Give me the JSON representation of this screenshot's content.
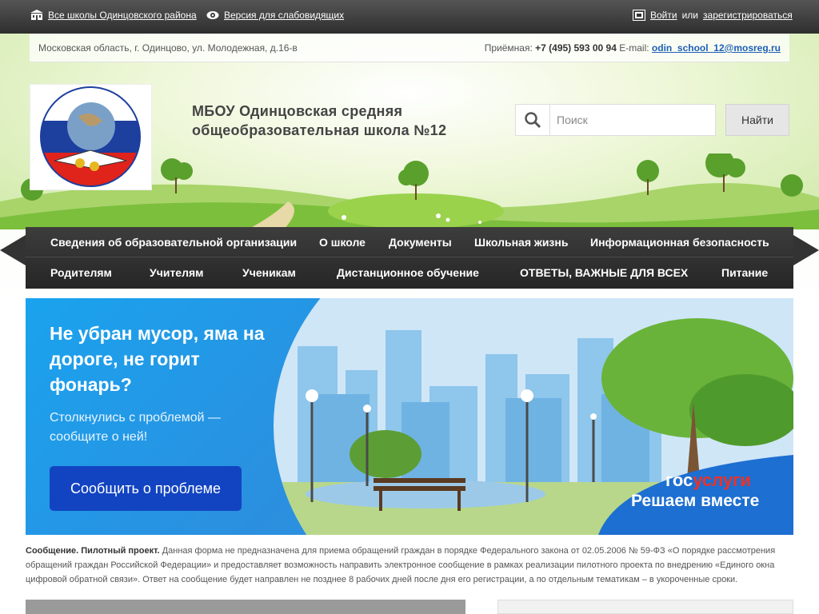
{
  "topbar": {
    "all_schools": "Все школы Одинцовского района",
    "low_vision": "Версия для слабовидящих",
    "login": "Войти",
    "or": "или",
    "register": "зарегистрироваться"
  },
  "address": "Московская область, г. Одинцово, ул. Молодежная, д.16-в",
  "contacts": {
    "reception_label": "Приёмная:",
    "phone": "+7 (495) 593 00 94",
    "email_label": "E-mail:",
    "email": "odin_school_12@mosreg.ru"
  },
  "school_name": "МБОУ Одинцовская средняя общеобразовательная школа №12",
  "search": {
    "placeholder": "Поиск",
    "button": "Найти"
  },
  "nav": {
    "row1": [
      "Сведения об образовательной организации",
      "О школе",
      "Документы",
      "Школьная жизнь",
      "Информационная безопасность"
    ],
    "row2": [
      "Родителям",
      "Учителям",
      "Ученикам",
      "Дистанционное обучение",
      "ОТВЕТЫ, ВАЖНЫЕ ДЛЯ ВСЕХ",
      "Питание"
    ]
  },
  "banner": {
    "title": "Не убран мусор, яма на дороге, не горит фонарь?",
    "subtitle": "Столкнулись с проблемой — сообщите о ней!",
    "button": "Сообщить о проблеме",
    "gos_part1": "гос",
    "gos_part2": "услуги",
    "slogan": "Решаем вместе"
  },
  "notice": {
    "bold": "Сообщение. Пилотный проект.",
    "text": "Данная форма не предназначена для приема обращений граждан в порядке Федерального закона от 02.05.2006 № 59-ФЗ «О порядке рассмотрения обращений граждан Российской Федерации» и предоставляет возможность направить электронное сообщение в рамках реализации пилотного проекта по внедрению «Единого окна цифровой обратной связи». Ответ на сообщение будет направлен не позднее 8 рабочих дней после дня его регистрации, а по отдельным тематикам – в укороченные сроки."
  },
  "icons": [
    "school-icon",
    "eye-icon",
    "login-icon",
    "search-icon"
  ],
  "colors": {
    "topbar": "#3a3a3a",
    "nav": "#2e2e2e",
    "banner": "#2b8fdf",
    "banner_button": "#1244c2",
    "link": "#1d5fb5"
  }
}
